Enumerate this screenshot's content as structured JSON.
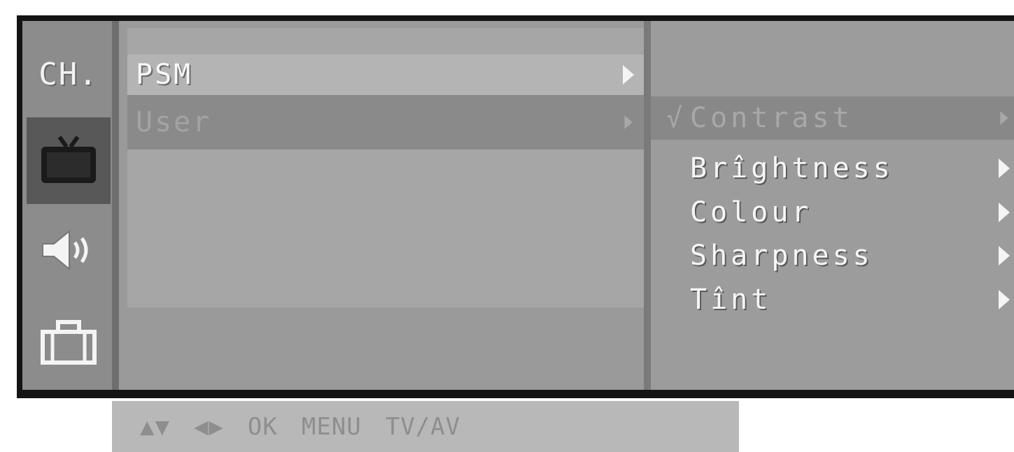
{
  "sidebar": {
    "items": [
      {
        "label": "CH.",
        "icon": "channel-icon",
        "active": false
      },
      {
        "icon": "tv-picture-icon",
        "active": true
      },
      {
        "icon": "speaker-icon",
        "active": false
      },
      {
        "icon": "briefcase-icon",
        "active": false
      }
    ]
  },
  "menu": {
    "items": [
      {
        "label": "PSM",
        "highlighted": true
      },
      {
        "label": "User",
        "dimmed": true
      }
    ]
  },
  "submenu": {
    "items": [
      {
        "label": "Contrast",
        "check": "√",
        "selected": true
      },
      {
        "label": "Brîghtness",
        "check": "",
        "selected": false
      },
      {
        "label": "Colour",
        "check": "",
        "selected": false
      },
      {
        "label": "Sharpness",
        "check": "",
        "selected": false
      },
      {
        "label": "Tînt",
        "check": "",
        "selected": false
      }
    ]
  },
  "help_bar": {
    "nav_updown": "▲▼",
    "nav_leftright": "◀▶",
    "ok": "OK",
    "menu": "MENU",
    "tvav": "TV/AV"
  },
  "colors": {
    "panel_bg": "#9a9a9a",
    "frame": "#141414",
    "text": "#f6f6f6",
    "selected_row": "#888888"
  }
}
